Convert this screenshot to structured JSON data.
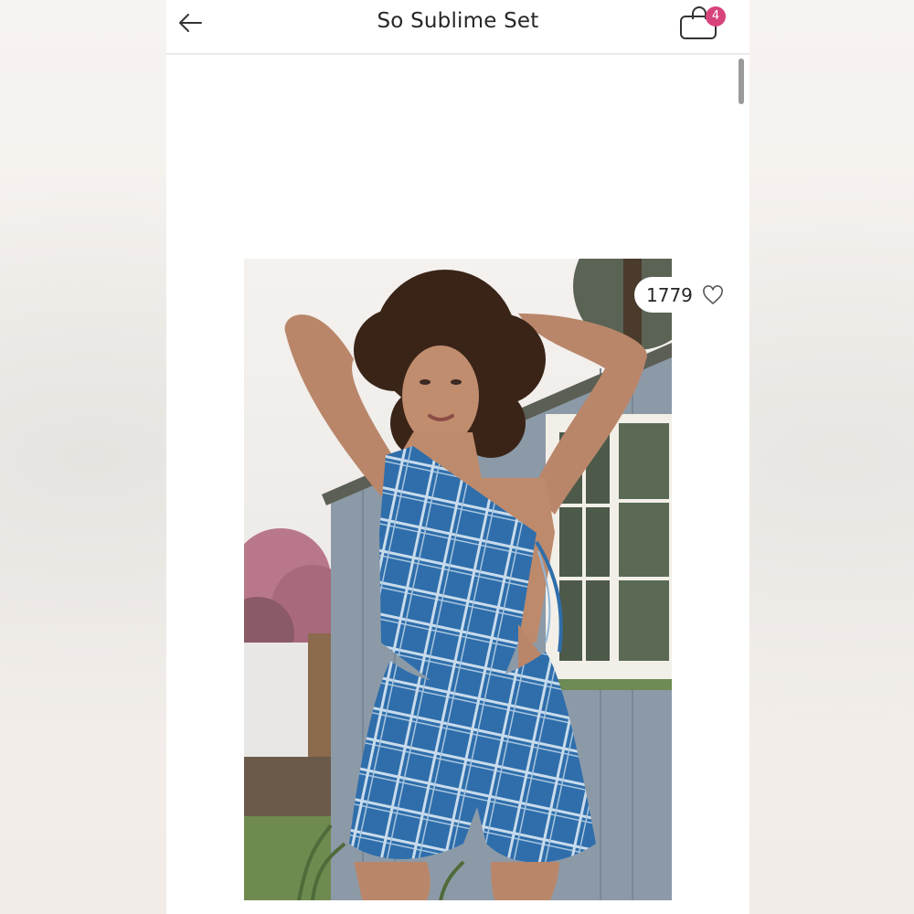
{
  "header": {
    "title": "So Sublime Set",
    "back_icon": "arrow-left-icon",
    "cart_icon": "shopping-bag-icon",
    "cart_count": "4"
  },
  "product": {
    "likes": "1779",
    "like_icon": "heart-outline-icon"
  },
  "colors": {
    "accent_badge": "#d8437c",
    "outfit_blue": "#2f6eab"
  }
}
